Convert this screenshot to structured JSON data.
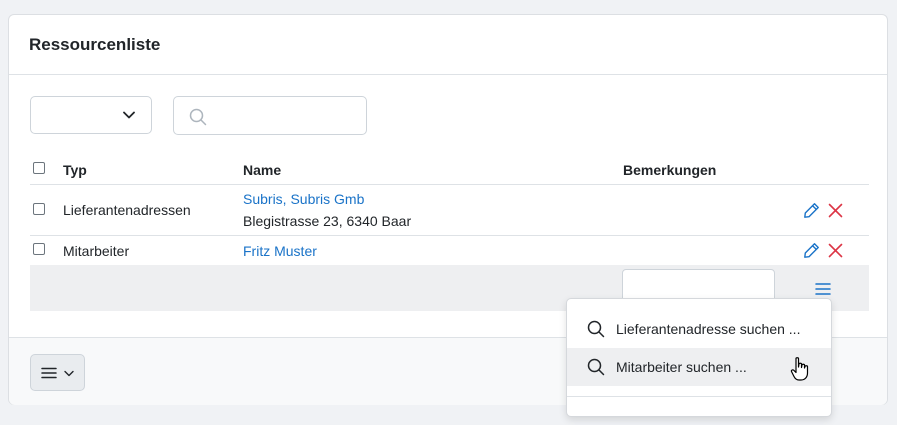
{
  "card": {
    "title": "Ressourcenliste"
  },
  "filter": {
    "selected": ""
  },
  "search": {
    "placeholder": "",
    "value": ""
  },
  "table": {
    "headers": {
      "typ": "Typ",
      "name": "Name",
      "bemerkungen": "Bemerkungen"
    },
    "rows": [
      {
        "typ": "Lieferantenadressen",
        "name": "Subris, Subris Gmb",
        "address": "Blegistrasse 23, 6340 Baar",
        "bemerkungen": ""
      },
      {
        "typ": "Mitarbeiter",
        "name": "Fritz Muster",
        "address": "",
        "bemerkungen": ""
      }
    ]
  },
  "dropdown": {
    "items": [
      {
        "label": "Lieferantenadresse suchen ...",
        "icon": "search-icon"
      },
      {
        "label": "Mitarbeiter suchen ...",
        "icon": "search-icon"
      }
    ]
  },
  "colors": {
    "link": "#1a73c8",
    "edit_icon": "#1a73c8",
    "delete_icon": "#dc3545",
    "menu_icon": "#1a73c8"
  }
}
